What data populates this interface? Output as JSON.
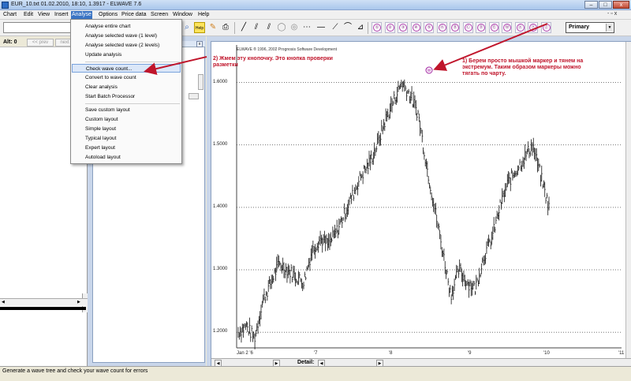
{
  "window": {
    "title": "EUR_10.txt  01.02.2010, 18:10, 1.3917 - ELWAVE 7.6",
    "min_label": "–",
    "max_label": "□",
    "close_label": "x"
  },
  "menubar": {
    "items": [
      "Chart",
      "Edit",
      "View",
      "Insert",
      "Analyse",
      "Options",
      "Price data",
      "Screen",
      "Window",
      "Help"
    ],
    "active": "Analyse",
    "mdi_controls": "- ▫ x"
  },
  "toolbar": {
    "wave_labels": [
      "①",
      "②",
      "③",
      "④",
      "⑤",
      "Ⓐ",
      "Ⓑ",
      "Ⓒ",
      "Ⓓ",
      "Ⓔ",
      "Ⓦ",
      "Ⓧ",
      "Ⓨ",
      "Ⓩ"
    ],
    "degree_select": "Primary"
  },
  "left_panel": {
    "alt_label": "Alt: 0",
    "prev_label": "<< prev",
    "next_label": "next"
  },
  "analyse_menu": {
    "items": [
      {
        "label": "Analyse entire chart"
      },
      {
        "label": "Analyse selected wave (1 level)"
      },
      {
        "label": "Analyse selected wave (2 levels)"
      },
      {
        "label": "Update analysis"
      },
      {
        "label": "Check wave count..."
      },
      {
        "label": "Convert to wave count"
      },
      {
        "label": "Clear analysis"
      },
      {
        "label": "Start Batch Processor"
      },
      {
        "label": "Save custom layout"
      },
      {
        "label": "Custom layout"
      },
      {
        "label": "Simple layout"
      },
      {
        "label": "Typical layout"
      },
      {
        "label": "Expert layout"
      },
      {
        "label": "Autoload layout"
      }
    ],
    "highlighted": "Check wave count..."
  },
  "chart": {
    "copyright": "ELWAVE ® 1996, 2002 Prognosis Software Development",
    "detail_label": "Detail:",
    "marker_label": "W",
    "annotations": {
      "left": "2) Жмем эту кнопочку. Это кнопка проверки\nразметки",
      "right": "1) Берем просто мышкой маркер и тянем на\nэкстремум. Таким образом маркеры можно\nтягать по чарту."
    }
  },
  "chart_data": {
    "type": "bar",
    "title": "",
    "xlabel": "",
    "ylabel": "",
    "ylim": [
      1.175,
      1.66
    ],
    "yticks": [
      "1.6000",
      "1.5000",
      "1.4000",
      "1.3000",
      "1.2000"
    ],
    "ytick_values": [
      1.6,
      1.5,
      1.4,
      1.3,
      1.2
    ],
    "xticks": [
      "Jan 2 '6",
      "'7",
      "'8",
      "'9",
      "'10",
      "'11"
    ],
    "grid": true,
    "series": [
      {
        "values": [
          1.2,
          1.21,
          1.19,
          1.25,
          1.28,
          1.31,
          1.3,
          1.29,
          1.28,
          1.33,
          1.35,
          1.34,
          1.36,
          1.39,
          1.42,
          1.45,
          1.47,
          1.5,
          1.54,
          1.57,
          1.6,
          1.58,
          1.55,
          1.47,
          1.4,
          1.33,
          1.26,
          1.3,
          1.28,
          1.27,
          1.32,
          1.35,
          1.4,
          1.44,
          1.46,
          1.48,
          1.5,
          1.45,
          1.4
        ]
      }
    ]
  },
  "status": {
    "text": "Generate a wave tree and check your wave count for errors"
  }
}
